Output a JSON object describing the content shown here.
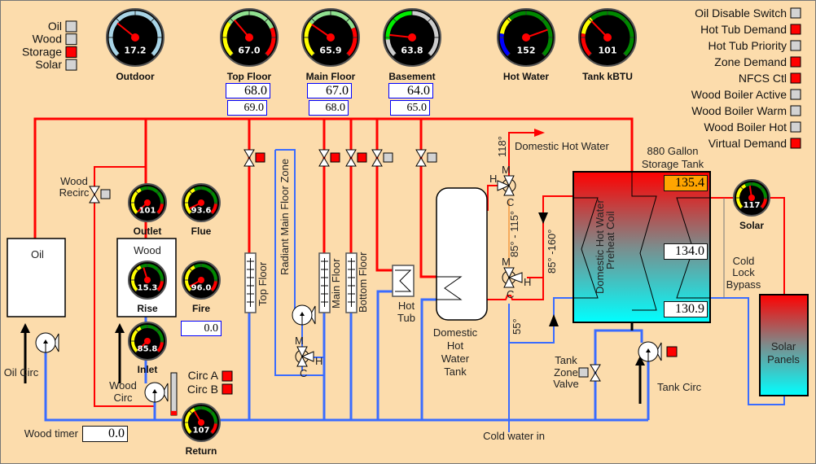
{
  "source_legend": [
    {
      "label": "Oil",
      "state": "off"
    },
    {
      "label": "Wood",
      "state": "off"
    },
    {
      "label": "Storage",
      "state": "on"
    },
    {
      "label": "Solar",
      "state": "off"
    }
  ],
  "status_legend": [
    {
      "label": "Oil Disable Switch",
      "state": "off"
    },
    {
      "label": "Hot Tub Demand",
      "state": "on"
    },
    {
      "label": "Hot Tub Priority",
      "state": "off"
    },
    {
      "label": "Zone Demand",
      "state": "on"
    },
    {
      "label": "NFCS Ctl",
      "state": "on"
    },
    {
      "label": "Wood Boiler Active",
      "state": "off"
    },
    {
      "label": "Wood Boiler Warm",
      "state": "off"
    },
    {
      "label": "Wood Boiler Hot",
      "state": "off"
    },
    {
      "label": "Virtual Demand",
      "state": "on"
    }
  ],
  "colors": {
    "on": "#ff0000",
    "off": "#d3d3d3",
    "hot_pipe": "#ff0000",
    "cold_pipe": "#3a6cff",
    "background": "#fcdcac",
    "setpoint_high": "#ffa500"
  },
  "gauges": [
    {
      "id": "outdoor",
      "label": "Outdoor",
      "value": "17.2",
      "num": 17.2,
      "min": -20,
      "max": 100,
      "style": "sky"
    },
    {
      "id": "top-floor",
      "label": "Top Floor",
      "value": "67.0",
      "num": 67.0,
      "min": 60,
      "max": 80,
      "style": "comfort"
    },
    {
      "id": "main-floor",
      "label": "Main Floor",
      "value": "65.9",
      "num": 65.9,
      "min": 60,
      "max": 80,
      "style": "comfort"
    },
    {
      "id": "basement",
      "label": "Basement",
      "value": "63.8",
      "num": 63.8,
      "min": 60,
      "max": 80,
      "style": "basement"
    },
    {
      "id": "hot-water",
      "label": "Hot Water",
      "value": "152",
      "num": 152,
      "min": 0,
      "max": 200,
      "style": "hotwater"
    },
    {
      "id": "tank-kbtu",
      "label": "Tank kBTU",
      "value": "101",
      "num": 101,
      "min": 0,
      "max": 300,
      "style": "kbtu"
    },
    {
      "id": "outlet",
      "label": "Outlet",
      "value": "101",
      "num": 101,
      "min": 100,
      "max": 220,
      "style": "boiler"
    },
    {
      "id": "flue",
      "label": "Flue",
      "value": "93.6",
      "num": 93.6,
      "min": 80,
      "max": 280,
      "style": "boiler"
    },
    {
      "id": "rise",
      "label": "Rise",
      "value": "15.3",
      "num": 15.3,
      "min": 0,
      "max": 35,
      "style": "boiler"
    },
    {
      "id": "fire",
      "label": "Fire",
      "value": "96.0",
      "num": 96.0,
      "min": 80,
      "max": 350,
      "style": "boiler"
    },
    {
      "id": "inlet",
      "label": "Inlet",
      "value": "85.8",
      "num": 85.8,
      "min": 85,
      "max": 220,
      "style": "boiler"
    },
    {
      "id": "return",
      "label": "Return",
      "value": "107",
      "num": 107,
      "min": 80,
      "max": 150,
      "style": "boiler"
    },
    {
      "id": "solar",
      "label": "Solar",
      "value": "117",
      "num": 117,
      "min": 0,
      "max": 250,
      "style": "boiler"
    }
  ],
  "setpoints": {
    "top_floor": {
      "target": "68.0",
      "high": "69.0"
    },
    "main_floor": {
      "target": "67.0",
      "high": "68.0"
    },
    "basement": {
      "target": "64.0",
      "high": "65.0"
    }
  },
  "storage_tank": {
    "title_line1": "880 Gallon",
    "title_line2": "Storage Tank",
    "top": "135.4",
    "middle": "134.0",
    "bottom": "130.9",
    "coil_line1": "Domestic Hot Water",
    "coil_line2": "Preheat Coil"
  },
  "labels": {
    "oil": "Oil",
    "wood": "Wood",
    "oil_circ": "Oil Circ",
    "wood_circ_1": "Wood",
    "wood_circ_2": "Circ",
    "wood_recirc_1": "Wood",
    "wood_recirc_2": "Recirc",
    "wood_timer": "Wood timer",
    "wood_timer_value": "0.0",
    "fire_value": "0.0",
    "circ_a": "Circ A",
    "circ_b": "Circ B",
    "top_floor_rad": "Top Floor",
    "main_floor_rad": "Main Floor",
    "bottom_floor_rad": "Bottom Floor",
    "radiant_zone": "Radiant Main Floor Zone",
    "hot_tub_1": "Hot",
    "hot_tub_2": "Tub",
    "dhw_tank_1": "Domestic",
    "dhw_tank_2": "Hot",
    "dhw_tank_3": "Water",
    "dhw_tank_4": "Tank",
    "domestic_hot_water": "Domestic Hot Water",
    "temp_118": "118°",
    "temp_85_115": "85° - 115°",
    "temp_85_160": "85° -160°",
    "temp_55": "55°",
    "cold_water_in": "Cold water in",
    "tank_zone_1": "Tank",
    "tank_zone_2": "Zone",
    "tank_zone_3": "Valve",
    "tank_circ": "Tank Circ",
    "cold_lock_1": "Cold",
    "cold_lock_2": "Lock",
    "cold_lock_3": "Bypass",
    "solar_panels_1": "Solar",
    "solar_panels_2": "Panels",
    "m": "M",
    "h": "H",
    "c": "C"
  },
  "valves": {
    "top_floor": "on",
    "main_floor": "on",
    "bottom_floor": "on",
    "hot_tub": "off",
    "dhw": "off",
    "wood_recirc": "off",
    "tank_zone": "off",
    "tank_circ": "on",
    "circ_a": "on",
    "circ_b": "on"
  },
  "wood_timer_bar_fraction": 0.1
}
